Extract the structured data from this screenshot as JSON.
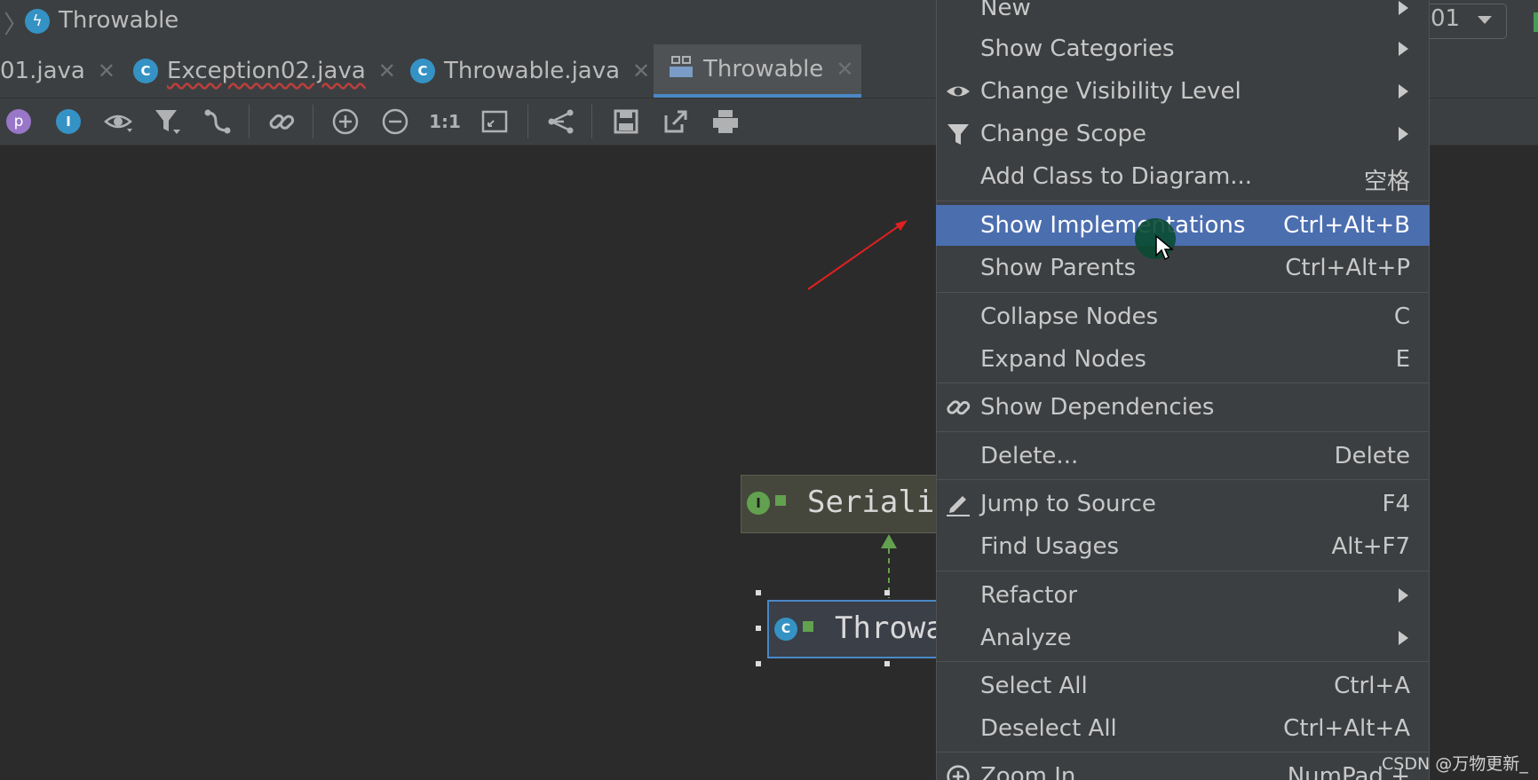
{
  "breadcrumb": {
    "title": "Throwable"
  },
  "run_config": {
    "label": "01"
  },
  "tabs": [
    {
      "label": "01.java"
    },
    {
      "label": "Exception02.java"
    },
    {
      "label": "Throwable.java"
    },
    {
      "label": "Throwable"
    }
  ],
  "toolbar": {
    "items": [
      "p",
      "I"
    ],
    "one_to_one_label": "1:1"
  },
  "diagram": {
    "node_serializable": "Seriali",
    "node_throwable": "Throwa",
    "interface_badge": "I",
    "class_badge": "C"
  },
  "menu": {
    "items": [
      {
        "label": "New",
        "shortcut": "",
        "submenu": true
      },
      {
        "label": "Show Categories",
        "shortcut": "",
        "submenu": true
      },
      {
        "label": "Change Visibility Level",
        "shortcut": "",
        "submenu": true
      },
      {
        "label": "Change Scope",
        "shortcut": "",
        "submenu": true
      },
      {
        "label": "Add Class to Diagram...",
        "shortcut": "空格",
        "submenu": false
      },
      {
        "label": "Show Implementations",
        "shortcut": "Ctrl+Alt+B",
        "submenu": false
      },
      {
        "label": "Show Parents",
        "shortcut": "Ctrl+Alt+P",
        "submenu": false
      },
      {
        "label": "Collapse Nodes",
        "shortcut": "C",
        "submenu": false
      },
      {
        "label": "Expand Nodes",
        "shortcut": "E",
        "submenu": false
      },
      {
        "label": "Show Dependencies",
        "shortcut": "",
        "submenu": false
      },
      {
        "label": "Delete...",
        "shortcut": "Delete",
        "submenu": false
      },
      {
        "label": "Jump to Source",
        "shortcut": "F4",
        "submenu": false
      },
      {
        "label": "Find Usages",
        "shortcut": "Alt+F7",
        "submenu": false
      },
      {
        "label": "Refactor",
        "shortcut": "",
        "submenu": true
      },
      {
        "label": "Analyze",
        "shortcut": "",
        "submenu": true
      },
      {
        "label": "Select All",
        "shortcut": "Ctrl+A",
        "submenu": false
      },
      {
        "label": "Deselect All",
        "shortcut": "Ctrl+Alt+A",
        "submenu": false
      },
      {
        "label": "Zoom In",
        "shortcut": "NumPad +",
        "submenu": false
      }
    ],
    "selected": "Show Implementations"
  },
  "watermark": "CSDN @万物更新_",
  "colors": {
    "selection": "#4b6eaf",
    "accent": "#4a88c7",
    "annotation_arrow": "#e02020"
  },
  "icons": [
    "lightning-icon",
    "eye-icon",
    "filter-icon",
    "link-icon",
    "pencil-icon",
    "zoom-in-icon"
  ]
}
